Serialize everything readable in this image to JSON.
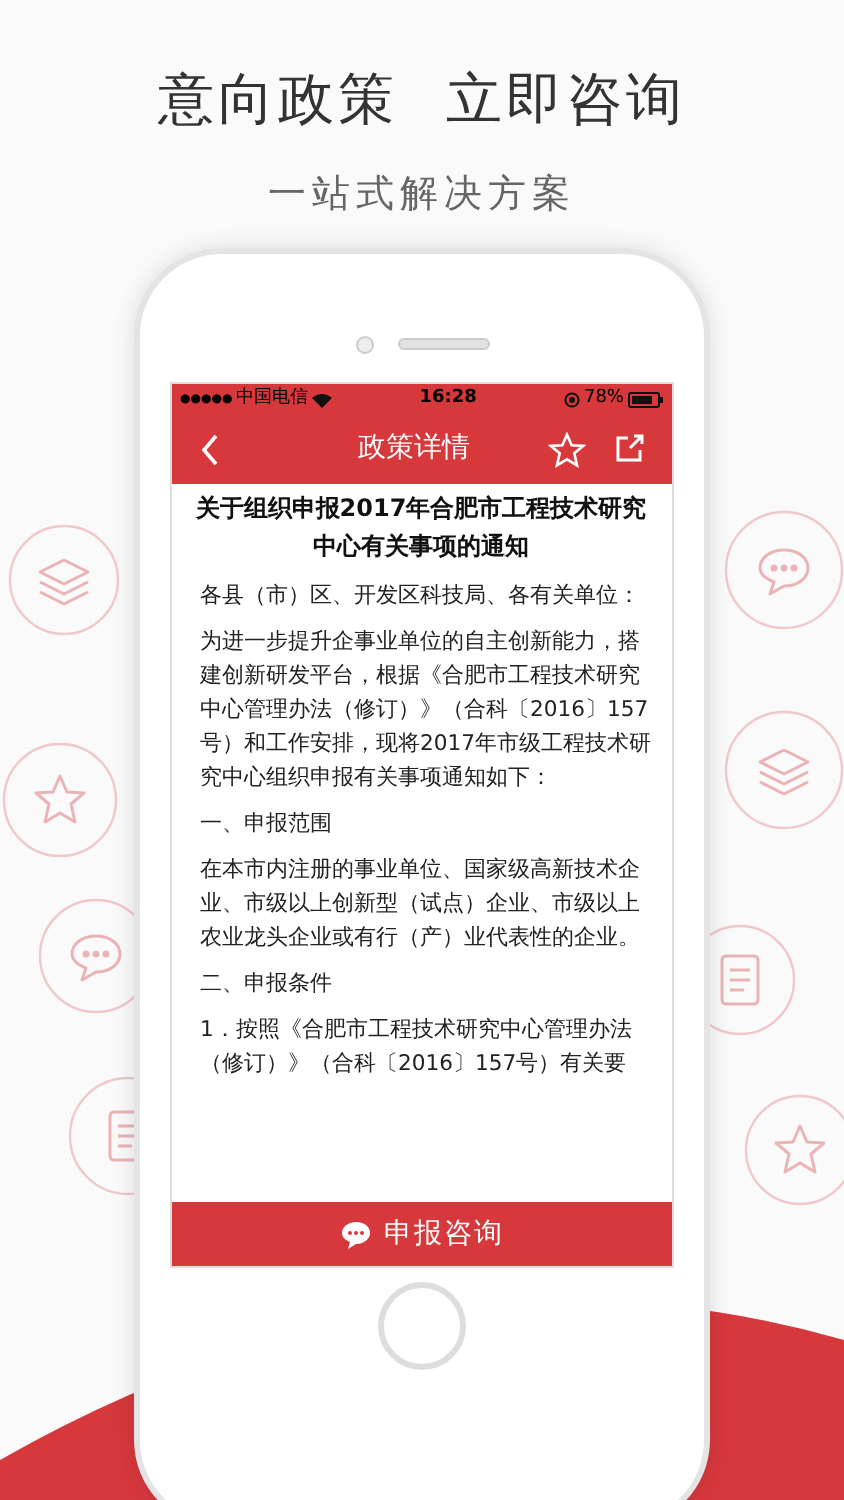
{
  "headline": [
    "意向政策",
    "立即咨询"
  ],
  "subtitle": "一站式解决方案",
  "status_bar": {
    "signal": "●●●●●",
    "carrier": "中国电信",
    "time": "16:28",
    "battery": "78%"
  },
  "nav_bar": {
    "title": "政策详情"
  },
  "article": {
    "title": "关于组织申报2017年合肥市工程技术研究中心有关事项的通知",
    "paragraphs": [
      "各县（市）区、开发区科技局、各有关单位：",
      "为进一步提升企事业单位的自主创新能力，搭建创新研发平台，根据《合肥市工程技术研究中心管理办法（修订）》（合科〔2016〕157号）和工作安排，现将2017年市级工程技术研究中心组织申报有关事项通知如下：",
      "一、申报范围",
      "在本市内注册的事业单位、国家级高新技术企业、市级以上创新型（试点）企业、市级以上农业龙头企业或有行（产）业代表性的企业。",
      "二、申报条件",
      "1．按照《合肥市工程技术研究中心管理办法（修订）》（合科〔2016〕157号）有关要"
    ]
  },
  "bottom_button": {
    "label": "申报咨询"
  }
}
